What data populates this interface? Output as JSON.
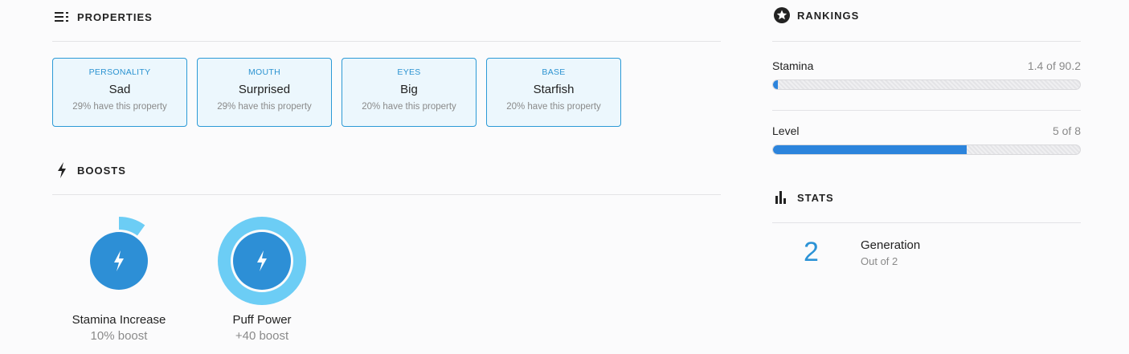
{
  "properties": {
    "title": "PROPERTIES",
    "items": [
      {
        "type": "PERSONALITY",
        "value": "Sad",
        "rarity": "29% have this property"
      },
      {
        "type": "MOUTH",
        "value": "Surprised",
        "rarity": "29% have this property"
      },
      {
        "type": "EYES",
        "value": "Big",
        "rarity": "20% have this property"
      },
      {
        "type": "BASE",
        "value": "Starfish",
        "rarity": "20% have this property"
      }
    ]
  },
  "boosts": {
    "title": "BOOSTS",
    "items": [
      {
        "name": "Stamina Increase",
        "value": "10% boost",
        "ring_fraction": 0.1
      },
      {
        "name": "Puff Power",
        "value": "+40 boost",
        "ring_fraction": 1.0
      }
    ]
  },
  "rankings": {
    "title": "RANKINGS",
    "items": [
      {
        "label": "Stamina",
        "value": "1.4 of 90.2",
        "fill_fraction": 0.016
      },
      {
        "label": "Level",
        "value": "5 of 8",
        "fill_fraction": 0.63
      }
    ]
  },
  "stats": {
    "title": "STATS",
    "items": [
      {
        "number": "2",
        "label": "Generation",
        "sub": "Out of 2"
      }
    ]
  },
  "colors": {
    "accent": "#2c84dc",
    "boost_core": "#2d8fd6",
    "boost_ring": "#6ccdf5",
    "card_border": "#2c9ad6",
    "card_bg": "#ecf7fd"
  },
  "icons": {
    "properties": "list-icon",
    "boosts": "lightning-icon",
    "rankings": "star-badge-icon",
    "stats": "bar-chart-icon"
  }
}
